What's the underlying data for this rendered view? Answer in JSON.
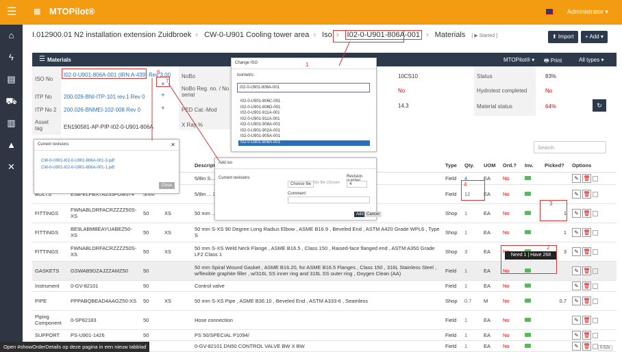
{
  "topbar": {
    "brand": "MTOPilot®",
    "user": "Administrator ▾"
  },
  "crumbs": [
    "I.012900.01 N2 installation extension Zuidbroek",
    "CW-0-U901 Cooling tower area",
    "Iso",
    "I02-0-U901-806A-001",
    "Materials"
  ],
  "crumb_started": "[ ▶ Started ]",
  "actions": {
    "import": "⬆ Import",
    "add": "+ Add ▾"
  },
  "panel": {
    "title": "Materials",
    "mtopilot": "MTOPilot® ▾",
    "print": "🖶 Print",
    "alltypes": "All types ▾"
  },
  "info": {
    "iso_no_label": "ISO No",
    "iso_no": "I02-0-U901-806A-001 (IRN A-439) Rev 3.00",
    "itp1_label": "ITP No",
    "itp1": "200.026-BNI-ITP-101 rev.1 Rev 0",
    "itp2_label": "ITP No 2",
    "itp2": "200.026-BNMEI-102-008 Rev 0",
    "asset_label": "Asset tag",
    "asset": "EN190581-AP-PIP-I02-0-U901-806A",
    "nobo_label": "NoBo",
    "nobo_reg_label": "NoBo Reg. no. / No serial",
    "ped_label": "PED Cat.-Mod",
    "xray_label": "X Ray %",
    "c1": "10CS10",
    "c2": "No",
    "c3": "14,3",
    "status_label": "Status",
    "status": "83%",
    "hydro_label": "Hydrotest completed",
    "hydro": "No",
    "matstat_label": "Material status",
    "matstat": "64%"
  },
  "search_placeholder": "Search",
  "table": {
    "headers": [
      "",
      "",
      "",
      "CH",
      "Description",
      "Type",
      "Qty.",
      "UOM",
      "Ord.?",
      "Inv.",
      "Picked?",
      "Options"
    ],
    "rows": [
      {
        "cat": "",
        "code": "",
        "sch": "",
        "ch": "",
        "desc": "5/8in S... Yellow Passivate - 6.10in",
        "type": "Field",
        "qty": "4",
        "uom": "EA",
        "ord": "No",
        "picked": ""
      },
      {
        "cat": "BOLTS",
        "code": "ESB-ELFBX7A2S3FOM574",
        "sch": "5mm",
        "ch": "",
        "desc": "5/8in ... 3.74 in ... v. Yellow Passivate -",
        "type": "Field",
        "qty": "12",
        "uom": "EA",
        "ord": "No",
        "picked": ""
      },
      {
        "cat": "FITTINGS",
        "code": "FWNABLDRFACRZZZZ50S-XS",
        "sch": "50",
        "ch": "XS",
        "desc": "50 mm ... Grade L... ed end , ASTM A350",
        "type": "Shop",
        "qty": "1",
        "uom": "EA",
        "ord": "No",
        "picked": "1"
      },
      {
        "cat": "FITTINGS",
        "code": "BE9LABMBEAYUABEZ50-XS",
        "sch": "50",
        "ch": "XS",
        "desc": "50 mm S-XS 90 Degree Long Radius Elbow , ASME B16.9 , Beveled End , ASTM A420 Grade WPL6 , Type S",
        "type": "Shop",
        "qty": "1",
        "uom": "EA",
        "ord": "No",
        "picked": "1"
      },
      {
        "cat": "FITTINGS",
        "code": "FWNABLDRFACRZZZZ50S-XS",
        "sch": "50",
        "ch": "XS",
        "desc": "50 mm S-XS Weld Neck Flange , ASME B16.5 , Class 150 , Raised-face flanged end , ASTM A350 Grade LF2 Class 1",
        "type": "Shop",
        "qty": "3",
        "uom": "EA",
        "ord": "No",
        "picked": "3"
      },
      {
        "cat": "GASKETS",
        "code": "GSWAB9DZAJZZAMZ50",
        "sch": "50",
        "ch": "",
        "desc": "50 mm Spiral Wound Gasket , ASME B16.20, for ASME B16.5 Flanges , Class 150 , 316L Stainless Steel , w/flexible graphite filler , w/316L SS inner ring and 316L SS outer ring , Oxygen Clean (AA)",
        "type": "Field",
        "qty": "1",
        "uom": "EA",
        "ord": "No",
        "picked": ""
      },
      {
        "cat": "Instrument",
        "code": "0-GV-82101",
        "sch": "50",
        "ch": "",
        "desc": "Control valve",
        "type": "Field",
        "qty": "1",
        "uom": "EA",
        "ord": "No",
        "picked": ""
      },
      {
        "cat": "PIPE",
        "code": "PPPABQBEAD4AAGZ50-XS",
        "sch": "50",
        "ch": "XS",
        "desc": "50 mm S-XS Pipe , ASME B36.10 , Beveled End , ASTM A333-6 , Seamless",
        "type": "Shop",
        "qty": "0.7",
        "uom": "M",
        "ord": "No",
        "picked": "0.7"
      },
      {
        "cat": "Piping Component",
        "code": "0-SP82183",
        "sch": "50",
        "ch": "",
        "desc": "Hose connection",
        "type": "Field",
        "qty": "1",
        "uom": "EA",
        "ord": "No",
        "picked": ""
      },
      {
        "cat": "SUPPORT",
        "code": "PS-U901-1426",
        "sch": "50",
        "ch": "",
        "desc": "PS 50/SPECIAL P1094/",
        "type": "Field",
        "qty": "1",
        "uom": "EA",
        "ord": "No",
        "picked": ""
      },
      {
        "cat": "",
        "code": "",
        "sch": "",
        "ch": "",
        "desc": "0-GV-82101 DN50 CONTROL VALVE BW X BW",
        "type": "Field",
        "qty": "1",
        "uom": "EA",
        "ord": "No",
        "picked": ""
      }
    ]
  },
  "tooltip": "Need 1 | Have 268",
  "annotations": [
    "1",
    "2",
    "3",
    "4",
    "6",
    "7"
  ],
  "modal_iso": {
    "title": "Change ISO",
    "label": "Isometric",
    "value": "I02-0-U901-806A-001",
    "options": [
      "I02-0-U901-806C-001",
      "I02-0-U901-806D-001",
      "I02-0-U901-911A-001",
      "I02-0-U901-911A-001",
      "I02-0-U901-908A-001",
      "I02-0-U901-902A-001",
      "I02-0-U901-905A-001",
      "I02-0-U901-806A-001"
    ]
  },
  "modal_rev": {
    "title": "Current revisions",
    "files": [
      "CW-0-U901-I02-0-U901-806A-001-3.pdf",
      "CW-0-U901-I02-0-U901-806A-001-1.pdf"
    ],
    "close": "Close"
  },
  "modal_add": {
    "title": "Add iso",
    "label": "Current revisions",
    "f1": "Choose file",
    "f2": "No file chosen",
    "revlabel": "Revision number",
    "rev": "4",
    "comment": "Comment",
    "add": "Add",
    "cancel": "Cancel"
  },
  "status_bar": "Open #showOrderDetails op deze pagina in een nieuw tabblad",
  "zoom": "0.52s"
}
